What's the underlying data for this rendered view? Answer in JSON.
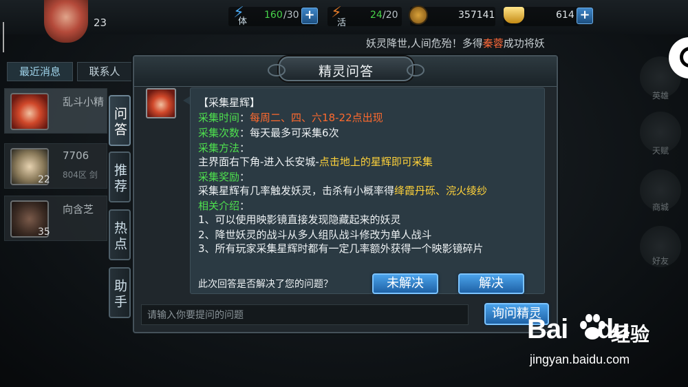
{
  "top": {
    "player_level": "23",
    "stamina": {
      "label": "体",
      "value": "160",
      "max": "/30"
    },
    "vitality": {
      "label": "活",
      "value": "24",
      "max": "/20"
    },
    "coins": "357141",
    "ingots": "614",
    "marquee_pre": "妖灵降世,人间危殆！多得",
    "marquee_name": "秦蓉",
    "marquee_post": "成功将妖"
  },
  "left_panel": {
    "tabs": [
      "最近消息",
      "联系人"
    ],
    "contacts": [
      {
        "name": "乱斗小精",
        "sub": "",
        "level": ""
      },
      {
        "name": "7706",
        "sub": "804区 剑",
        "level": "22"
      },
      {
        "name": "向含芝",
        "sub": "",
        "level": "35"
      }
    ]
  },
  "dialog": {
    "title": "精灵问答",
    "side_tabs": [
      "问答",
      "推荐",
      "热点",
      "助手"
    ],
    "content": {
      "heading": "【采集星辉】",
      "time_label": "采集时间",
      "time_value": "每周二、四、六18-22点出现",
      "count_label": "采集次数",
      "count_value": "每天最多可采集6次",
      "method_label": "采集方法",
      "method_pre": "主界面右下角-进入长安城-",
      "method_hl": "点击地上的星辉即可采集",
      "reward_label": "采集奖励",
      "reward_pre": "采集星辉有几率触发妖灵，击杀有小概率得",
      "reward_hl": "绛霞丹砾、浣火绫纱",
      "intro_label": "相关介绍",
      "intro_items": [
        "1、可以使用映影镜直接发现隐藏起来的妖灵",
        "2、降世妖灵的战斗从多人组队战斗修改为单人战斗",
        "3、所有玩家采集星辉时都有一定几率额外获得一个映影镜碎片"
      ],
      "colon": "："
    },
    "solve_question": "此次回答是否解决了您的问题？",
    "unsolved_btn": "未解决",
    "solved_btn": "解决",
    "input_placeholder": "请输入你要提问的问题",
    "ask_btn": "询问精灵"
  },
  "right_icons": [
    "英雄",
    "天赋",
    "商城",
    "好友"
  ],
  "watermark": {
    "logo": "Bai",
    "logo2": "du",
    "brand": "经验",
    "url": "jingyan.baidu.com"
  }
}
